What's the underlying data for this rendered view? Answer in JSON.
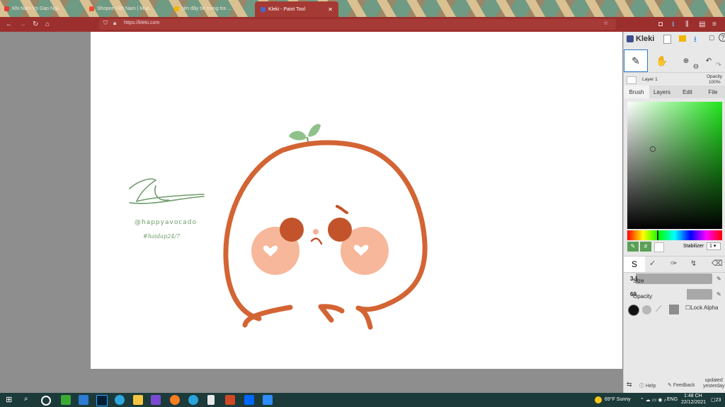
{
  "browser": {
    "tabs": [
      {
        "title": "Khi Nam Vs Gạo Ngủ ...",
        "color": "#e53935"
      },
      {
        "title": "Shopee Việt Nam | Mua ...",
        "color": "#ee4d2d"
      },
      {
        "title": "rèn đây bé trứng tra ...",
        "color": "#f4b400"
      },
      {
        "title": "Kleki - Paint Tool",
        "color": "#4a67c7",
        "active": true
      }
    ],
    "url": "https://kleki.com"
  },
  "canvas": {
    "signature": "@happyavocado",
    "hashtag": "#haidap24/7"
  },
  "panel": {
    "brand": "Kleki",
    "layer_name": "Layer 1",
    "opacity_label": "Opacity",
    "opacity_value": "100%",
    "tabs": [
      "Brush",
      "Layers",
      "Edit",
      "File"
    ],
    "active_tab": "Brush",
    "stabilizer_label": "Stabilizer",
    "stabilizer_value": "1",
    "size_label": "Size",
    "size_value": "3.1",
    "brush_opacity_label": "Opacity",
    "brush_opacity_value": "60",
    "lock_alpha": "Lock Alpha",
    "help": "Help",
    "feedback": "Feedback",
    "updated": "updated",
    "updated_when": "yesterday",
    "size_fraction": 0.1,
    "opacity_fraction": 0.7
  },
  "taskbar": {
    "weather": "69°F  Sunny",
    "lang": "ENG",
    "time": "1:48 CH",
    "date": "22/12/2021",
    "notif": "23"
  }
}
